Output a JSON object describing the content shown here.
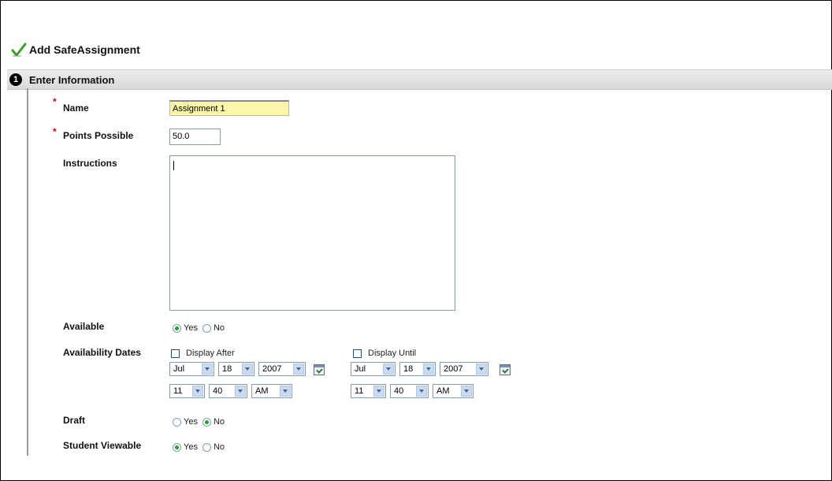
{
  "page": {
    "title": "Add SafeAssignment",
    "title_icon": "green-check-icon"
  },
  "section": {
    "step": "1",
    "title": "Enter Information"
  },
  "form": {
    "name": {
      "label": "Name",
      "required": true,
      "value": "Assignment 1"
    },
    "points": {
      "label": "Points Possible",
      "required": true,
      "value": "50.0"
    },
    "instructions": {
      "label": "Instructions",
      "value": ""
    },
    "available": {
      "label": "Available",
      "options": [
        "Yes",
        "No"
      ],
      "selected": "Yes"
    },
    "availability_dates": {
      "label": "Availability Dates",
      "display_after": {
        "label": "Display After",
        "checked": false,
        "month": "Jul",
        "day": "18",
        "year": "2007",
        "hour": "11",
        "minute": "40",
        "ampm": "AM"
      },
      "display_until": {
        "label": "Display Until",
        "checked": false,
        "month": "Jul",
        "day": "18",
        "year": "2007",
        "hour": "11",
        "minute": "40",
        "ampm": "AM"
      }
    },
    "draft": {
      "label": "Draft",
      "options": [
        "Yes",
        "No"
      ],
      "selected": "No"
    },
    "student_viewable": {
      "label": "Student Viewable",
      "options": [
        "Yes",
        "No"
      ],
      "selected": "Yes"
    }
  },
  "colors": {
    "required_mark": "#d00000",
    "highlight_input": "#fbf6a8",
    "radio_selected": "#21a121"
  }
}
